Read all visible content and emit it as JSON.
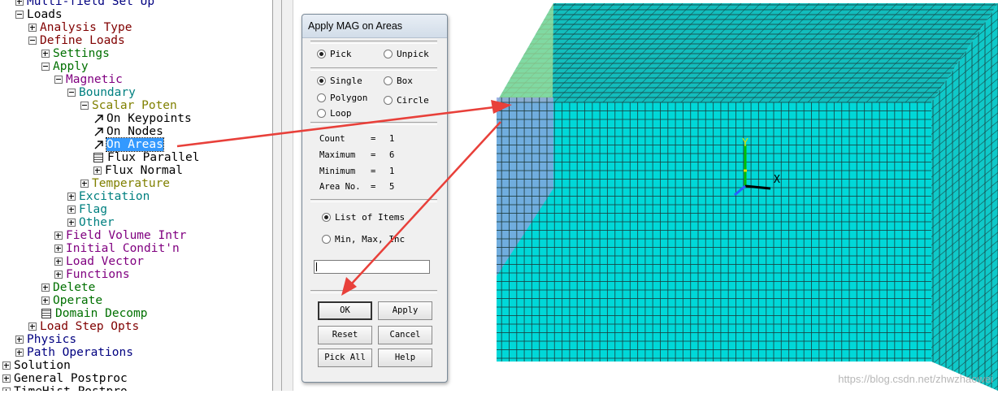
{
  "tree": {
    "items": [
      {
        "label": "Multi-field Set Up",
        "level": 2,
        "box": "plus",
        "color": "c-blue"
      },
      {
        "label": "Loads",
        "level": 2,
        "box": "minus",
        "color": "c-blk"
      },
      {
        "label": "Analysis Type",
        "level": 3,
        "box": "plus",
        "color": "c-mar"
      },
      {
        "label": "Define Loads",
        "level": 3,
        "box": "minus",
        "color": "c-mar"
      },
      {
        "label": "Settings",
        "level": 4,
        "box": "plus",
        "color": "c-grn"
      },
      {
        "label": "Apply",
        "level": 4,
        "box": "minus",
        "color": "c-grn"
      },
      {
        "label": "Magnetic",
        "level": 5,
        "box": "minus",
        "color": "c-purp"
      },
      {
        "label": "Boundary",
        "level": 6,
        "box": "minus",
        "color": "c-teal"
      },
      {
        "label": "Scalar Poten",
        "level": 7,
        "box": "minus",
        "color": "c-olive"
      },
      {
        "label": "On Keypoints",
        "level": 8,
        "icon": "arrow",
        "color": "c-blk"
      },
      {
        "label": "On Nodes",
        "level": 8,
        "icon": "arrow",
        "color": "c-blk"
      },
      {
        "label": "On Areas",
        "level": 8,
        "icon": "arrow",
        "color": "c-blk",
        "selected": true
      },
      {
        "label": "Flux Parallel",
        "level": 8,
        "icon": "grid",
        "color": "c-blk"
      },
      {
        "label": "Flux Normal",
        "level": 8,
        "box": "plus",
        "color": "c-blk"
      },
      {
        "label": "Temperature",
        "level": 7,
        "box": "plus",
        "color": "c-olive"
      },
      {
        "label": "Excitation",
        "level": 6,
        "box": "plus",
        "color": "c-teal"
      },
      {
        "label": "Flag",
        "level": 6,
        "box": "plus",
        "color": "c-teal"
      },
      {
        "label": "Other",
        "level": 6,
        "box": "plus",
        "color": "c-teal"
      },
      {
        "label": "Field Volume Intr",
        "level": 5,
        "box": "plus",
        "color": "c-purp"
      },
      {
        "label": "Initial Condit'n",
        "level": 5,
        "box": "plus",
        "color": "c-purp"
      },
      {
        "label": "Load Vector",
        "level": 5,
        "box": "plus",
        "color": "c-purp"
      },
      {
        "label": "Functions",
        "level": 5,
        "box": "plus",
        "color": "c-purp"
      },
      {
        "label": "Delete",
        "level": 4,
        "box": "plus",
        "color": "c-grn"
      },
      {
        "label": "Operate",
        "level": 4,
        "box": "plus",
        "color": "c-grn"
      },
      {
        "label": "Domain Decomp",
        "level": 4,
        "icon": "grid",
        "color": "c-grn"
      },
      {
        "label": "Load Step Opts",
        "level": 3,
        "box": "plus",
        "color": "c-mar"
      },
      {
        "label": "Physics",
        "level": 2,
        "box": "plus",
        "color": "c-blue"
      },
      {
        "label": "Path Operations",
        "level": 2,
        "box": "plus",
        "color": "c-blue"
      },
      {
        "label": "Solution",
        "level": 1,
        "box": "plus",
        "color": "c-blk"
      },
      {
        "label": "General Postproc",
        "level": 1,
        "box": "plus",
        "color": "c-blk"
      },
      {
        "label": "TimeHist Postpro",
        "level": 1,
        "box": "plus",
        "color": "c-blk"
      }
    ]
  },
  "dialog": {
    "title": "Apply MAG on Areas",
    "pick": "Pick",
    "unpick": "Unpick",
    "single": "Single",
    "box": "Box",
    "polygon": "Polygon",
    "circle": "Circle",
    "loop": "Loop",
    "count_label": "Count",
    "count_value": "1",
    "max_label": "Maximum",
    "max_value": "6",
    "min_label": "Minimum",
    "min_value": "1",
    "area_label": "Area No.",
    "area_value": "5",
    "eq": "=",
    "list_items": "List of Items",
    "min_max_inc": "Min, Max, Inc",
    "entry_value": "",
    "ok": "OK",
    "apply": "Apply",
    "reset": "Reset",
    "cancel": "Cancel",
    "pick_all": "Pick All",
    "help": "Help"
  },
  "viewport": {
    "axis_y": "Y",
    "axis_x": "X",
    "mesh_color": "#00d4d4",
    "top_color": "#10b8b8",
    "left_face_color": "#8a9ed8",
    "highlight_color": "#9adf90",
    "watermark": "https://blog.csdn.net/zhwzhaowei"
  },
  "colors": {
    "annotation_arrow": "#e8403a",
    "selection": "#3399ff"
  }
}
